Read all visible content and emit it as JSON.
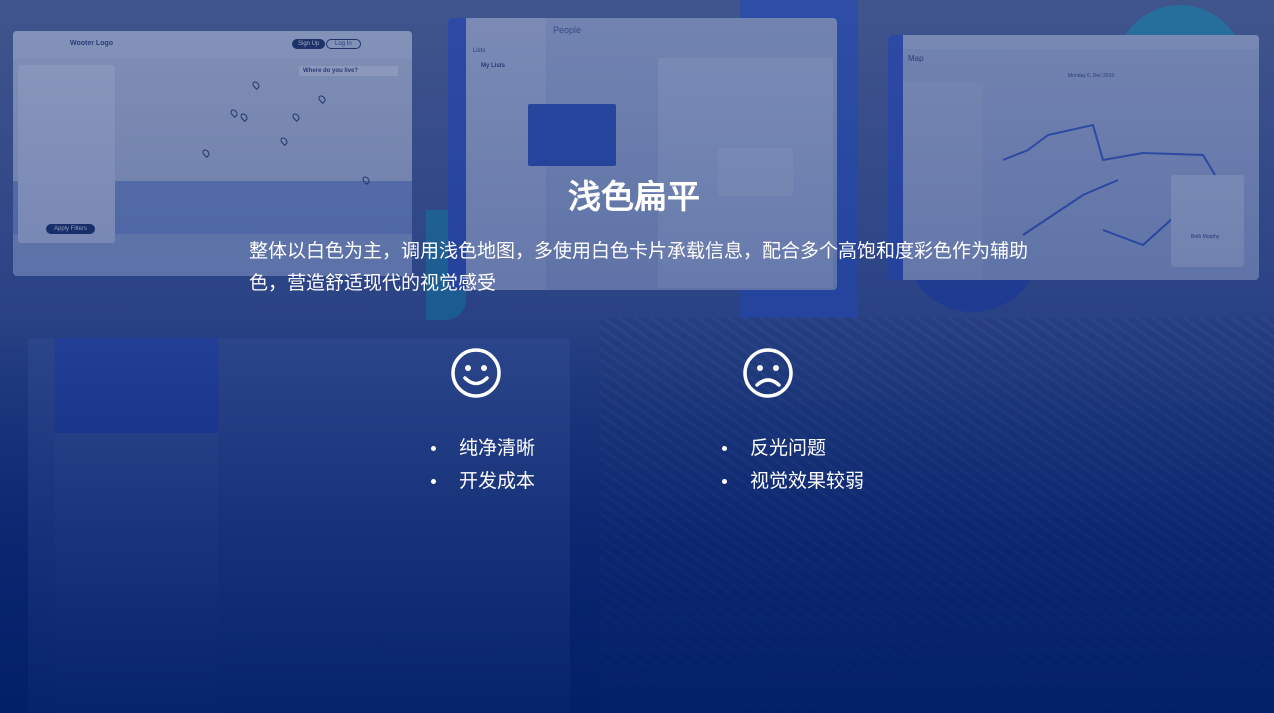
{
  "slide": {
    "title": "浅色扁平",
    "description": "整体以白色为主，调用浅色地图，多使用白色卡片承载信息，配合多个高饱和度彩色作为辅助色，营造舒适现代的视觉感受"
  },
  "pros": {
    "icon": "smile-icon",
    "items": [
      "纯净清晰",
      "开发成本"
    ]
  },
  "cons": {
    "icon": "frown-icon",
    "items": [
      "反光问题",
      "视觉效果较弱"
    ]
  },
  "background_screens": {
    "map_app": {
      "logo": "Wooter Logo",
      "signup": "Sign Up",
      "login": "Log In",
      "search": "Where do you live?",
      "apply": "Apply Filters"
    },
    "people_app": {
      "title": "People",
      "lists": "Lists",
      "my_lists": "My Lists"
    },
    "route_app": {
      "title": "Map",
      "date": "Monday 6, Dec 2019",
      "person": "Beth Murphy"
    }
  },
  "colors": {
    "background_top": "#4b5f95",
    "background_bottom": "#02206a",
    "text": "#ffffff"
  }
}
